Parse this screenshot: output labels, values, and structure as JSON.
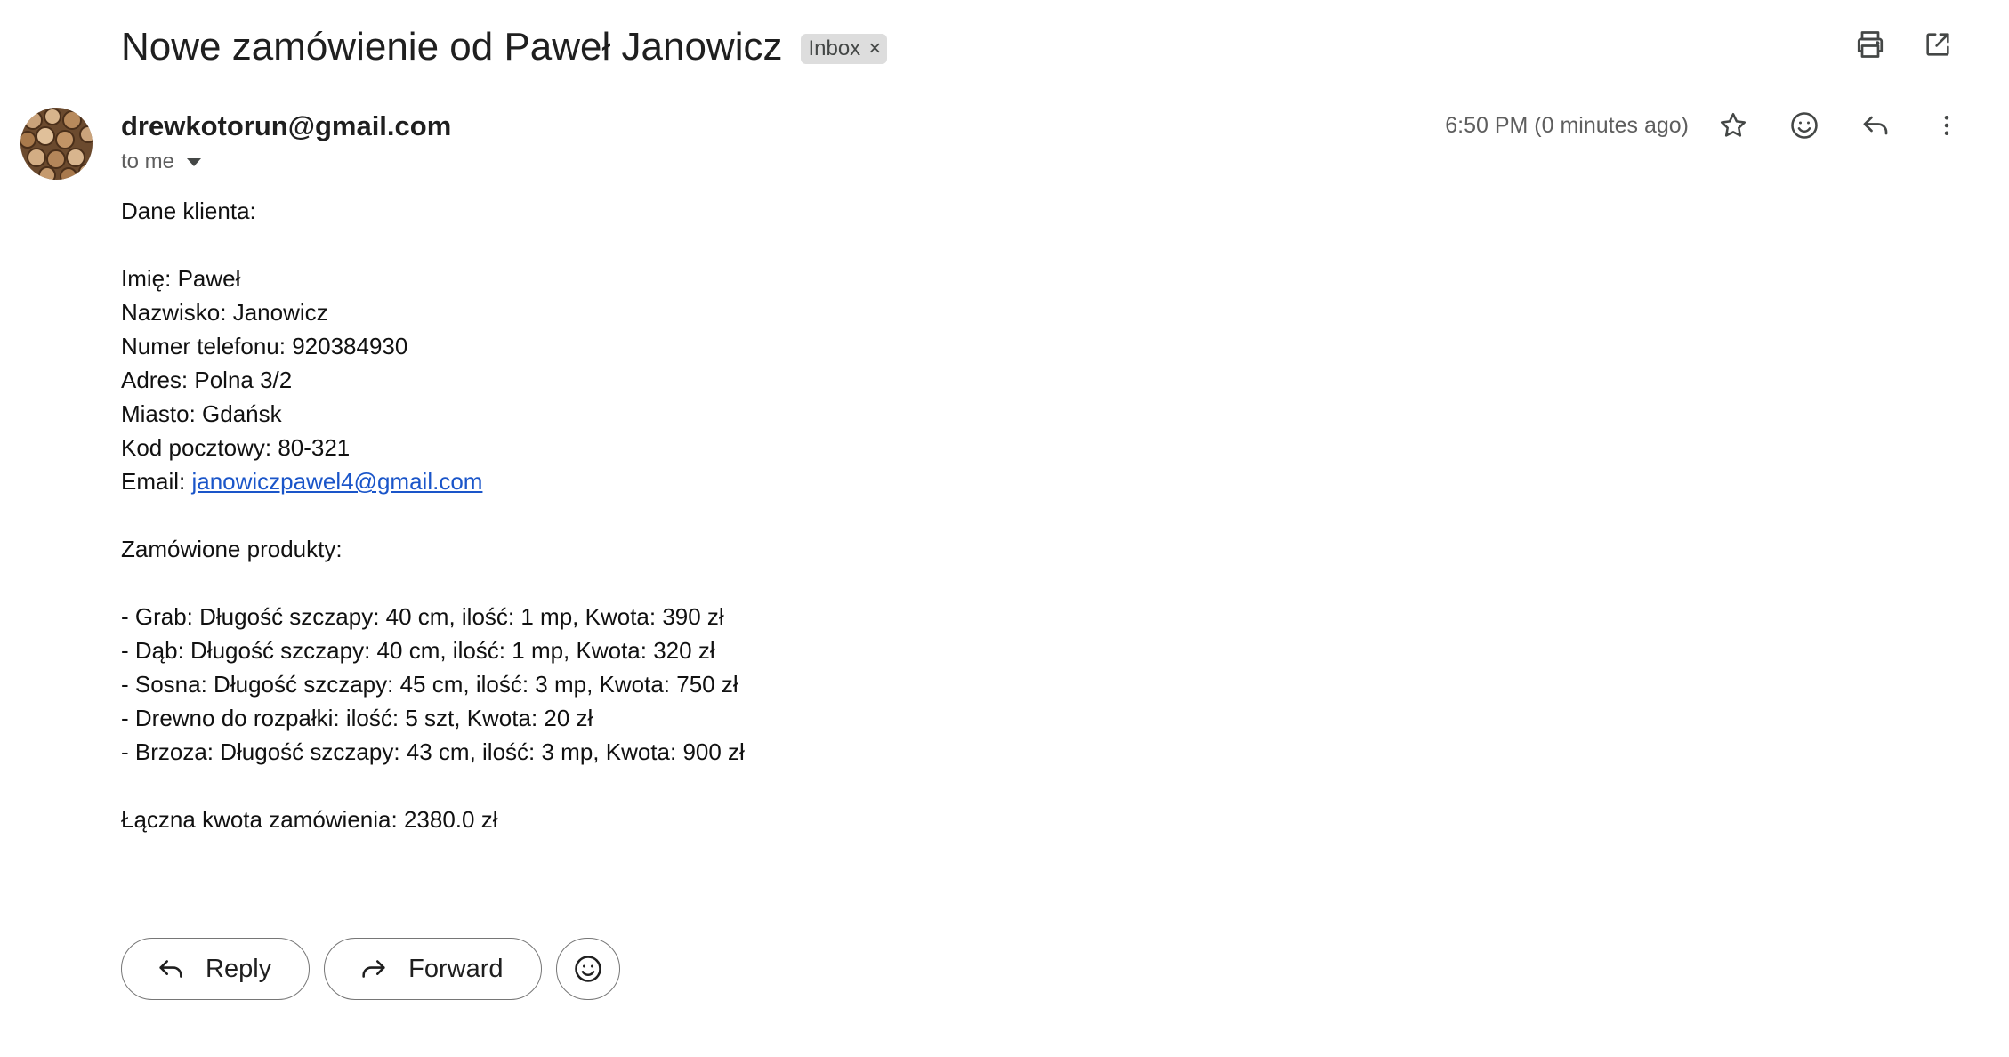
{
  "email": {
    "subject": "Nowe zamówienie od Paweł Janowicz",
    "label": "Inbox",
    "label_remove": "×",
    "sender": "drewkotorun@gmail.com",
    "recipient": "to me",
    "timestamp": "6:50 PM (0 minutes ago)",
    "avatar_description": "firewood-logs"
  },
  "toolbar": {
    "icons": [
      "print-icon",
      "open-in-new-window-icon"
    ]
  },
  "message_actions": {
    "icons": [
      "star-icon",
      "emoji-reaction-icon",
      "reply-icon",
      "more-vertical-icon"
    ]
  },
  "body": {
    "heading_customer": "Dane klienta:",
    "first_name": "Imię: Paweł",
    "last_name": "Nazwisko: Janowicz",
    "phone": "Numer telefonu: 920384930",
    "address": "Adres: Polna 3/2",
    "city": "Miasto: Gdańsk",
    "postal_code": "Kod pocztowy: 80-321",
    "email_label": "Email: ",
    "email_link": "janowiczpawel4@gmail.com",
    "heading_products": "Zamówione produkty:",
    "products": [
      "- Grab: Długość szczapy: 40 cm, ilość: 1 mp, Kwota: 390 zł",
      "- Dąb: Długość szczapy: 40 cm, ilość: 1 mp, Kwota: 320 zł",
      "- Sosna: Długość szczapy: 45 cm, ilość: 3 mp, Kwota: 750 zł",
      "- Drewno do rozpałki: ilość: 5 szt, Kwota: 20 zł",
      "- Brzoza: Długość szczapy: 43 cm, ilość: 3 mp, Kwota: 900 zł"
    ],
    "total": "Łączna kwota zamówienia: 2380.0 zł"
  },
  "footer": {
    "reply_label": "Reply",
    "forward_label": "Forward"
  }
}
